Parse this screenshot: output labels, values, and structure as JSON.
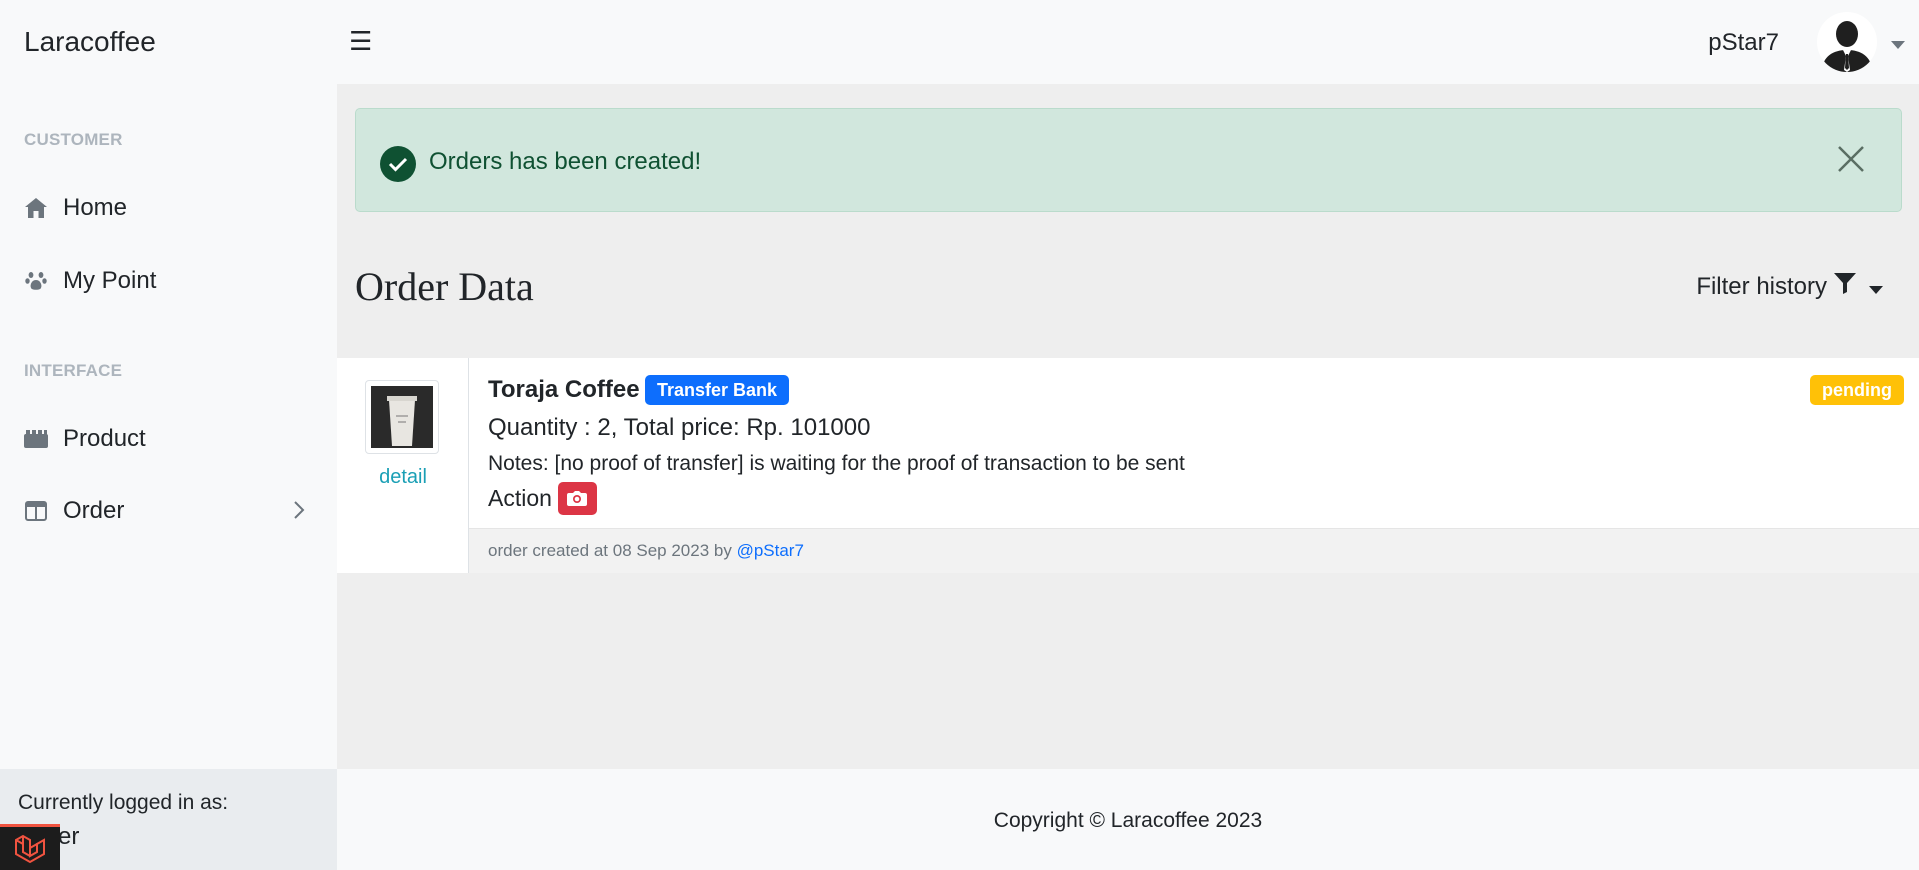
{
  "app": {
    "brand": "Laracoffee"
  },
  "sidebar": {
    "sections": [
      {
        "heading": "CUSTOMER",
        "items": [
          {
            "label": "Home",
            "icon": "home-icon"
          },
          {
            "label": "My Point",
            "icon": "paw-icon"
          }
        ]
      },
      {
        "heading": "INTERFACE",
        "items": [
          {
            "label": "Product",
            "icon": "product-icon"
          },
          {
            "label": "Order",
            "icon": "columns-icon"
          }
        ]
      }
    ],
    "footer": {
      "label": "Currently logged in as:",
      "role": "tomer"
    }
  },
  "topbar": {
    "menu_icon": "☰",
    "username": "pStar7"
  },
  "alert": {
    "message": "Orders has been created!",
    "type": "success"
  },
  "page": {
    "title": "Order Data",
    "filter_label": "Filter history"
  },
  "orders": [
    {
      "product": "Toraja Coffee",
      "payment": "Transfer Bank",
      "status": "pending",
      "summary": "Quantity : 2, Total price: Rp. 101000",
      "notes": "Notes: [no proof of transfer] is waiting for the proof of transaction to be sent",
      "action_label": "Action",
      "detail_label": "detail",
      "footer_prefix": "order created at 08 Sep 2023 by",
      "footer_user": "@pStar7"
    }
  ],
  "footer": {
    "copyright": "Copyright © Laracoffee 2023"
  },
  "colors": {
    "primary": "#0d6efd",
    "warning": "#ffc107",
    "danger": "#dc3545",
    "success_bg": "#d1e7dd",
    "success_text": "#0f5132"
  }
}
